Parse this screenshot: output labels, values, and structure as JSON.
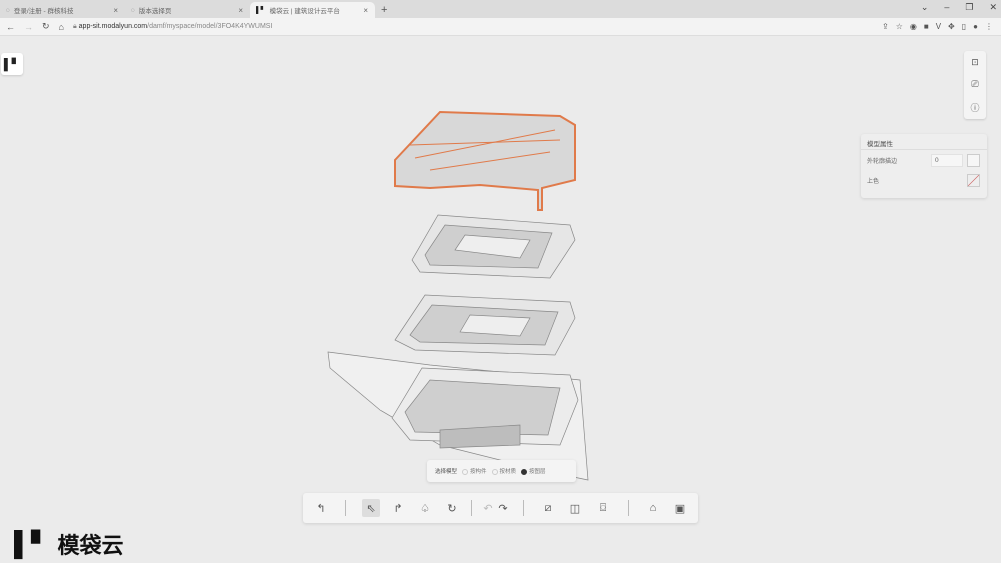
{
  "browser": {
    "tabs": [
      {
        "title": "登录/注册 - 群核科技",
        "active": false
      },
      {
        "title": "版本选择页",
        "active": false
      },
      {
        "title": "模袋云 | 建筑设计云平台",
        "active": true
      }
    ],
    "url_host": "app-sit.modalyun.com",
    "url_path": "/damf/myspace/model/3FO4K4YWUMSI"
  },
  "app": {
    "logo_mark": "▌▘",
    "brand_name": "模袋云"
  },
  "properties_panel": {
    "title": "模型属性",
    "outline_label": "外轮廓描边",
    "outline_value": "0",
    "color_label": "上色"
  },
  "select_mode": {
    "label": "选择模型",
    "options": [
      {
        "label": "按构件",
        "selected": false
      },
      {
        "label": "按材质",
        "selected": false
      },
      {
        "label": "按图层",
        "selected": true
      }
    ]
  },
  "accent_color": "#e07a4a"
}
